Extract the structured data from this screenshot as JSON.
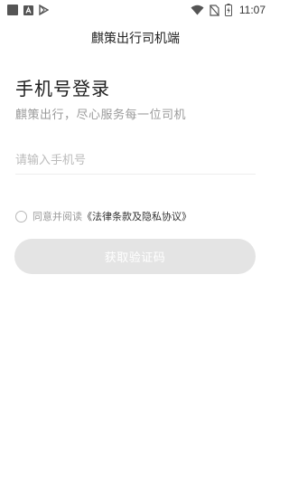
{
  "status_bar": {
    "left_icons": [
      "notification-square-icon",
      "app-a-icon",
      "play-store-icon"
    ],
    "right_icons": [
      "wifi-icon",
      "no-sim-icon",
      "battery-icon"
    ],
    "time": "11:07"
  },
  "header": {
    "title": "麒策出行司机端"
  },
  "login": {
    "heading": "手机号登录",
    "subtitle": "麒策出行，尽心服务每一位司机",
    "phone_placeholder": "请输入手机号",
    "agree_prefix": "同意并阅读",
    "agree_link": "《法律条款及隐私协议》",
    "get_code_label": "获取验证码"
  },
  "colors": {
    "button_disabled_bg": "#e4e4e4",
    "muted_text": "#9a9a9a",
    "placeholder": "#bbbbbb"
  }
}
